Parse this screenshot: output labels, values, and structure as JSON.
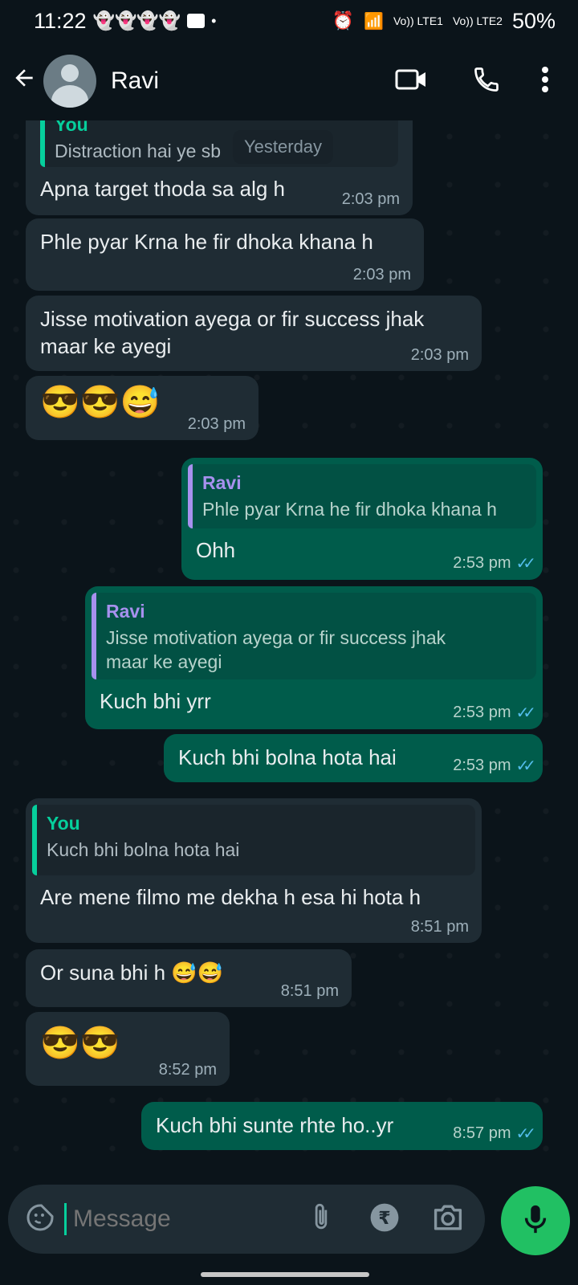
{
  "status_bar": {
    "time": "11:22",
    "network1": "Vo)) LTE1",
    "network2": "Vo)) LTE2",
    "battery": "50%"
  },
  "header": {
    "contact_name": "Ravi"
  },
  "date_chip": "Yesterday",
  "messages": [
    {
      "quote_name": "You",
      "quote_text": "Distraction hai ye sb",
      "text": "Apna target thoda sa alg h",
      "time": "2:03 pm"
    },
    {
      "text": "Phle pyar Krna he fir dhoka khana h",
      "time": "2:03 pm"
    },
    {
      "text": "Jisse motivation ayega or fir success jhak maar ke ayegi",
      "time": "2:03 pm"
    },
    {
      "text": "😎😎😅",
      "time": "2:03 pm"
    },
    {
      "quote_name": "Ravi",
      "quote_text": "Phle pyar Krna he fir dhoka khana h",
      "text": "Ohh",
      "time": "2:53 pm"
    },
    {
      "quote_name": "Ravi",
      "quote_text": "Jisse motivation ayega or fir success jhak maar ke ayegi",
      "text": "Kuch bhi yrr",
      "time": "2:53 pm"
    },
    {
      "text": "Kuch bhi bolna hota hai",
      "time": "2:53 pm"
    },
    {
      "quote_name": "You",
      "quote_text": "Kuch bhi bolna hota hai",
      "text": "Are mene filmo me dekha h esa hi hota h",
      "time": "8:51 pm"
    },
    {
      "text": "Or suna bhi h 😅😅",
      "time": "8:51 pm"
    },
    {
      "text": "😎😎",
      "time": "8:52 pm"
    },
    {
      "text": "Kuch bhi sunte rhte ho..yr",
      "time": "8:57 pm"
    }
  ],
  "input": {
    "placeholder": "Message"
  },
  "icons": {
    "back": "arrow-left-icon",
    "video": "video-call-icon",
    "call": "phone-icon",
    "menu": "more-vert-icon",
    "emoji": "sticker-icon",
    "attach": "paperclip-icon",
    "rupee": "rupee-payment-icon",
    "camera": "camera-icon",
    "mic": "mic-icon"
  },
  "colors": {
    "incoming": "#1f2c34",
    "outgoing": "#005c4b",
    "accent": "#21c063",
    "read_ticks": "#53bdeb"
  }
}
